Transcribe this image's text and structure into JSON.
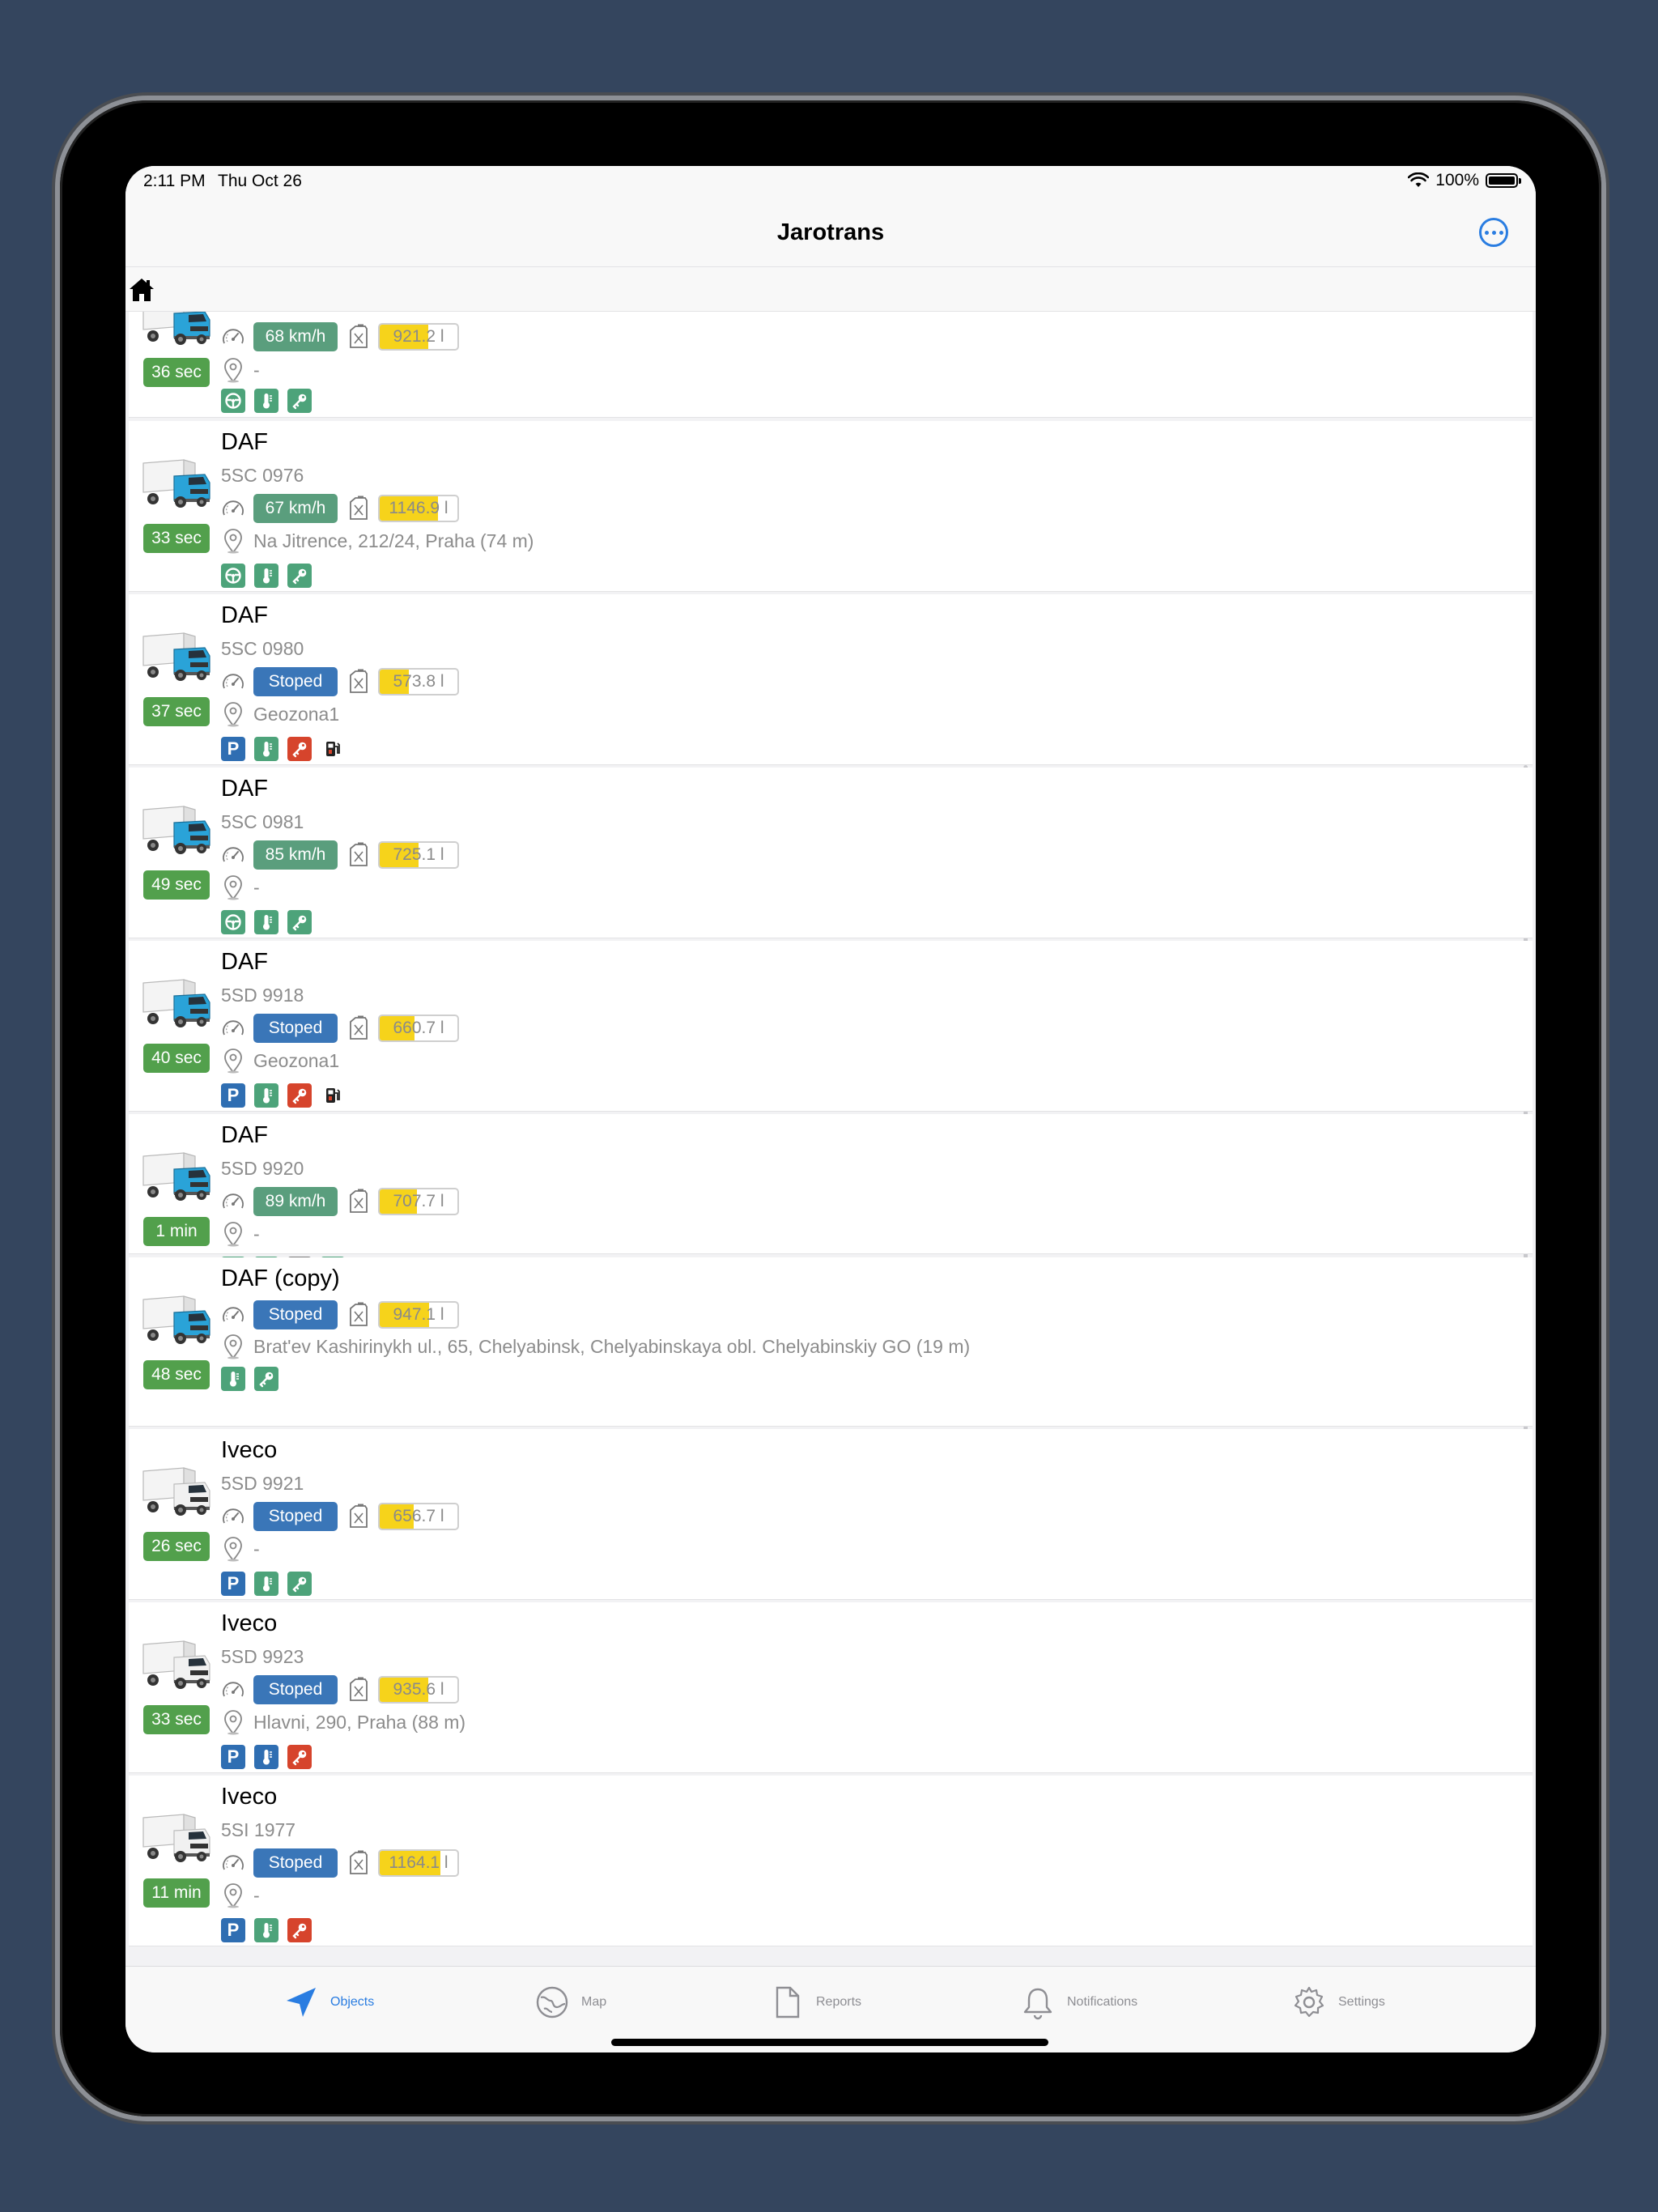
{
  "status_bar": {
    "time": "2:11 PM",
    "date": "Thu Oct 26",
    "battery": "100%"
  },
  "nav": {
    "title": "Jarotrans"
  },
  "vehicles": [
    {
      "name": "",
      "plate": "",
      "state": "moving",
      "speed": "68 km/h",
      "fuel": "921.2 l",
      "fuel_level": 0.62,
      "address": "-",
      "age": "36 sec",
      "icons": [
        "steering-wheel",
        "thermometer",
        "key"
      ],
      "truck_color": "blue"
    },
    {
      "name": "DAF",
      "plate": "5SC 0976",
      "state": "moving",
      "speed": "67 km/h",
      "fuel": "1146.9 l",
      "fuel_level": 0.75,
      "address": "Na Jitrence, 212/24, Praha (74 m)",
      "age": "33 sec",
      "icons": [
        "steering-wheel",
        "thermometer",
        "key"
      ],
      "truck_color": "blue"
    },
    {
      "name": "DAF",
      "plate": "5SC 0980",
      "state": "stopped",
      "speed": "Stoped",
      "fuel": "573.8 l",
      "fuel_level": 0.38,
      "address": "Geozona1",
      "age": "37 sec",
      "icons": [
        "parking",
        "thermometer",
        "key-red",
        "fuel-pump"
      ],
      "truck_color": "blue"
    },
    {
      "name": "DAF",
      "plate": "5SC 0981",
      "state": "moving",
      "speed": "85 km/h",
      "fuel": "725.1 l",
      "fuel_level": 0.5,
      "address": "-",
      "age": "49 sec",
      "icons": [
        "steering-wheel",
        "thermometer",
        "key"
      ],
      "truck_color": "blue"
    },
    {
      "name": "DAF",
      "plate": "5SD 9918",
      "state": "stopped",
      "speed": "Stoped",
      "fuel": "660.7 l",
      "fuel_level": 0.45,
      "address": "Geozona1",
      "age": "40 sec",
      "icons": [
        "parking",
        "thermometer",
        "key-red",
        "fuel-pump"
      ],
      "truck_color": "blue"
    },
    {
      "name": "DAF",
      "plate": "5SD 9920",
      "state": "moving",
      "speed": "89 km/h",
      "fuel": "707.7 l",
      "fuel_level": 0.48,
      "address": "-",
      "age": "1 min",
      "icons": [
        "steering-wheel",
        "thermometer",
        "brake",
        "key"
      ],
      "truck_color": "blue"
    },
    {
      "name": "DAF (copy)",
      "plate": "",
      "state": "stopped",
      "speed": "Stoped",
      "fuel": "947.1 l",
      "fuel_level": 0.64,
      "address": "Brat'ev Kashirinykh ul., 65, Chelyabinsk, Chelyabinskaya obl. Chelyabinskiy GO (19 m)",
      "age": "48 sec",
      "icons": [
        "thermometer",
        "key"
      ],
      "truck_color": "blue"
    },
    {
      "name": "Iveco",
      "plate": "5SD 9921",
      "state": "stopped",
      "speed": "Stoped",
      "fuel": "656.7 l",
      "fuel_level": 0.44,
      "address": "-",
      "age": "26 sec",
      "icons": [
        "parking",
        "thermometer",
        "key"
      ],
      "truck_color": "white"
    },
    {
      "name": "Iveco",
      "plate": "5SD 9923",
      "state": "stopped",
      "speed": "Stoped",
      "fuel": "935.6 l",
      "fuel_level": 0.63,
      "address": "Hlavni, 290, Praha (88 m)",
      "age": "33 sec",
      "icons": [
        "parking",
        "thermometer-blue",
        "key-red"
      ],
      "truck_color": "white"
    },
    {
      "name": "Iveco",
      "plate": "5SI 1977",
      "state": "stopped",
      "speed": "Stoped",
      "fuel": "1164.1 l",
      "fuel_level": 0.78,
      "address": "-",
      "age": "11 min",
      "icons": [
        "parking",
        "thermometer",
        "key-red"
      ],
      "truck_color": "white"
    }
  ],
  "tabs": [
    {
      "label": "Objects",
      "icon": "location-arrow-icon",
      "active": true
    },
    {
      "label": "Map",
      "icon": "globe-icon",
      "active": false
    },
    {
      "label": "Reports",
      "icon": "document-icon",
      "active": false
    },
    {
      "label": "Notifications",
      "icon": "bell-icon",
      "active": false
    },
    {
      "label": "Settings",
      "icon": "gear-icon",
      "active": false
    }
  ],
  "colors": {
    "moving": "#5a9e7d",
    "stopped": "#3a76b8",
    "age_badge": "#52a04c",
    "fuel": "#f6d31b",
    "accent": "#2a7de1"
  }
}
